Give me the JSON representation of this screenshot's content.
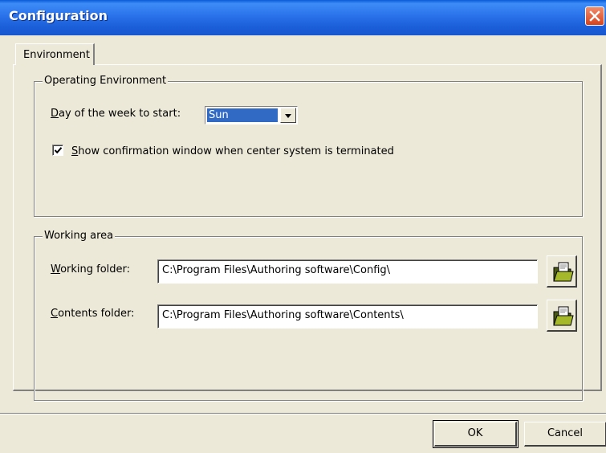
{
  "window": {
    "title": "Configuration",
    "close_icon": "close-icon"
  },
  "tabs": [
    {
      "label": "Environment",
      "active": true
    }
  ],
  "operating_environment": {
    "legend": "Operating Environment",
    "day_label_prefix": "D",
    "day_label_rest": "ay of the week to start:",
    "day_value": "Sun",
    "confirm_checked": true,
    "confirm_label_prefix": "S",
    "confirm_label_rest": "how confirmation window when center system is terminated"
  },
  "working_area": {
    "legend": "Working area",
    "working_label_prefix": "W",
    "working_label_rest": "orking folder:",
    "working_value": "C:\\Program Files\\Authoring software\\Config\\",
    "contents_label_prefix": "C",
    "contents_label_rest": "ontents folder:",
    "contents_value": "C:\\Program Files\\Authoring software\\Contents\\",
    "browse_icon": "folder-open-icon"
  },
  "buttons": {
    "ok": "OK",
    "cancel": "Cancel"
  },
  "colors": {
    "titlebar": "#1b5fd9",
    "selection": "#316ac5",
    "face": "#ece9d8"
  }
}
